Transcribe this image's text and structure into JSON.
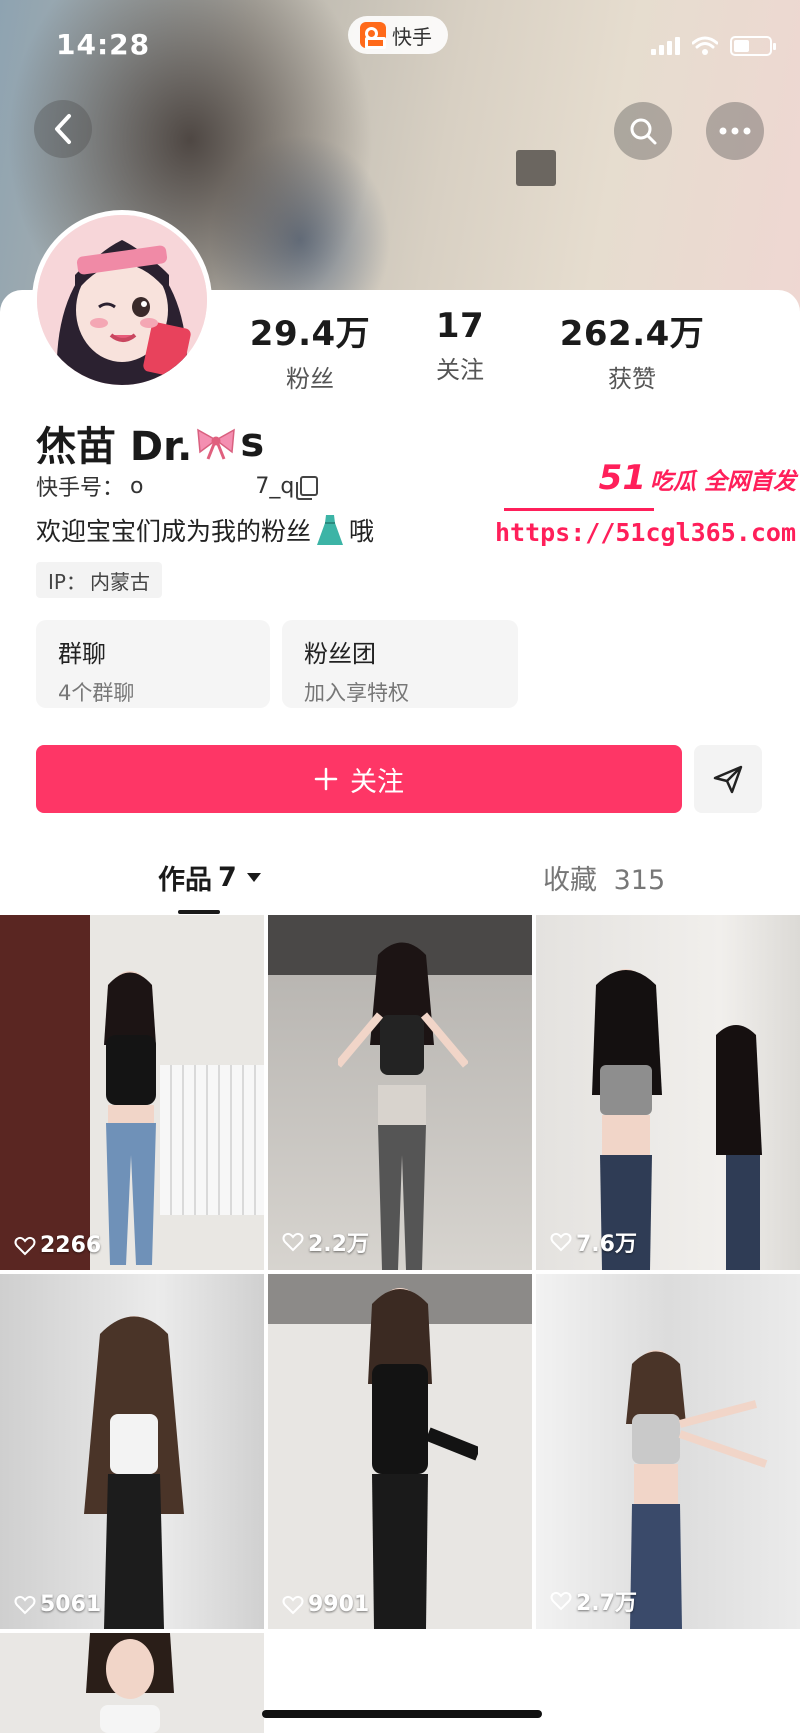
{
  "status_bar": {
    "time": "14:28",
    "app_name": "快手"
  },
  "nav": {
    "back_icon": "chevron-left-icon",
    "search_icon": "search-icon",
    "more_icon": "more-dots-icon"
  },
  "profile": {
    "stats": [
      {
        "value": "29.4万",
        "label": "粉丝"
      },
      {
        "value": "17",
        "label": "关注"
      },
      {
        "value": "262.4万",
        "label": "获赞"
      }
    ],
    "name_prefix": "烋苗 Dr.",
    "name_suffix": "s",
    "kuaishou_id_label": "快手号：",
    "kuaishou_id_value": "o                7_q",
    "bio_prefix": "欢迎宝宝们成为我的粉丝",
    "bio_suffix": "哦",
    "ip_label": "IP：",
    "ip_value": "内蒙古"
  },
  "groups": [
    {
      "title": "群聊",
      "subtitle": "4个群聊"
    },
    {
      "title": "粉丝团",
      "subtitle": "加入享特权"
    }
  ],
  "actions": {
    "follow_label": "关注",
    "follow_icon": "plus-icon",
    "share_icon": "send-icon"
  },
  "tabs": {
    "works_label": "作品",
    "works_count": "7",
    "favorites_label": "收藏",
    "favorites_count": "315"
  },
  "videos": [
    {
      "likes": "2266"
    },
    {
      "likes": "2.2万"
    },
    {
      "likes": "7.6万"
    },
    {
      "likes": "5061"
    },
    {
      "likes": "9901"
    },
    {
      "likes": "2.7万"
    },
    {
      "likes": ""
    }
  ],
  "watermark": {
    "brand_num": "51",
    "brand_text": "吃瓜 全网首发",
    "url": "https://51cgl365.com"
  },
  "colors": {
    "accent": "#fe3666",
    "watermark": "#ff1f5a"
  }
}
